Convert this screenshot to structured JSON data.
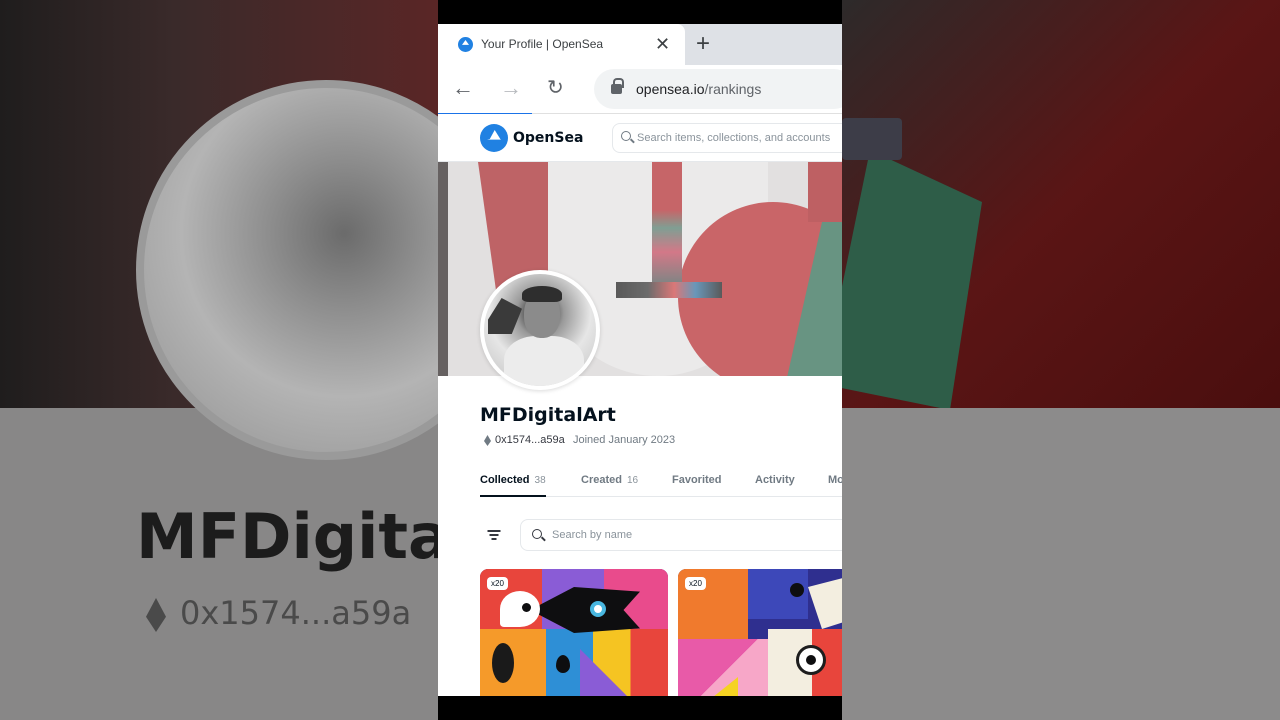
{
  "backdrop": {
    "name": "MFDigitalA",
    "address": "0x1574...a59a"
  },
  "browser": {
    "tab_title": "Your Profile | OpenSea",
    "tab_close": "✕",
    "new_tab": "+",
    "back": "←",
    "forward": "→",
    "reload": "↻",
    "url_host": "opensea.io",
    "url_path": "/rankings"
  },
  "opensea": {
    "brand": "OpenSea",
    "search_placeholder": "Search items, collections, and accounts"
  },
  "profile": {
    "name": "MFDigitalArt",
    "address": "0x1574...a59a",
    "joined": "Joined January 2023"
  },
  "tabs": [
    {
      "label": "Collected",
      "count": "38"
    },
    {
      "label": "Created",
      "count": "16"
    },
    {
      "label": "Favorited",
      "count": ""
    },
    {
      "label": "Activity",
      "count": ""
    },
    {
      "label": "Mo",
      "count": ""
    }
  ],
  "item_search": {
    "placeholder": "Search by name"
  },
  "cards": [
    {
      "badge": "x20"
    },
    {
      "badge": "x20"
    }
  ],
  "colors": {
    "opensea_blue": "#2081e2",
    "text_primary": "#04111d",
    "text_secondary": "#707a83"
  }
}
